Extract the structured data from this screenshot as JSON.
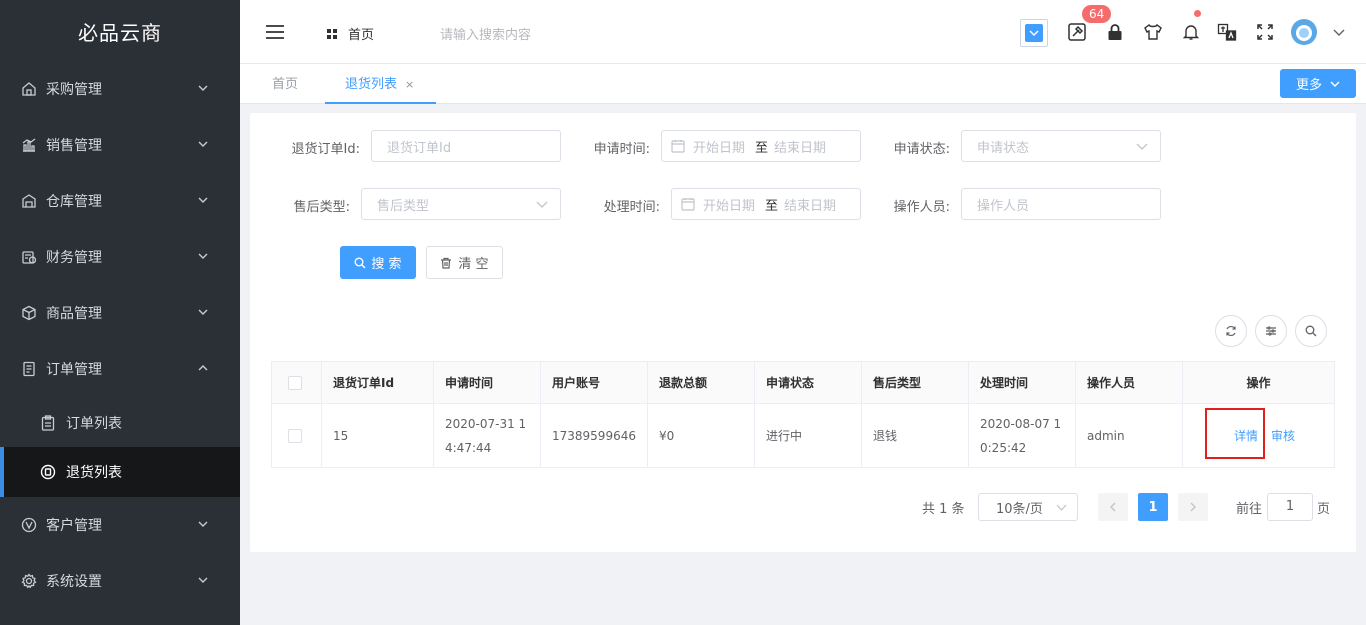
{
  "app": {
    "brand": "必品云商"
  },
  "sidebar": {
    "items": [
      {
        "label": "采购管理",
        "icon": "purchase-icon"
      },
      {
        "label": "销售管理",
        "icon": "sales-chart-icon"
      },
      {
        "label": "仓库管理",
        "icon": "warehouse-icon"
      },
      {
        "label": "财务管理",
        "icon": "finance-icon"
      },
      {
        "label": "商品管理",
        "icon": "box-icon"
      },
      {
        "label": "订单管理",
        "icon": "order-doc-icon"
      },
      {
        "label": "客户管理",
        "icon": "customer-icon"
      },
      {
        "label": "系统设置",
        "icon": "gear-icon"
      }
    ],
    "sub_items": [
      {
        "label": "订单列表",
        "icon": "clipboard-icon"
      },
      {
        "label": "退货列表",
        "icon": "return-icon"
      }
    ]
  },
  "header": {
    "home": "首页",
    "search_placeholder": "请输入搜索内容",
    "badge_count": "64"
  },
  "tabs": [
    {
      "label": "首页"
    },
    {
      "label": "退货列表",
      "close": "×"
    }
  ],
  "more_button": "更多",
  "form": {
    "order_id_label": "退货订单Id:",
    "order_id_placeholder": "退货订单Id",
    "apply_time_label": "申请时间:",
    "start_date": "开始日期",
    "to": "至",
    "end_date": "结束日期",
    "status_label": "申请状态:",
    "status_placeholder": "申请状态",
    "after_type_label": "售后类型:",
    "after_type_placeholder": "售后类型",
    "process_time_label": "处理时间:",
    "operator_label": "操作人员:",
    "operator_placeholder": "操作人员",
    "search_button": "搜 索",
    "clear_button": "清 空"
  },
  "table": {
    "headers": [
      "退货订单Id",
      "申请时间",
      "用户账号",
      "退款总额",
      "申请状态",
      "售后类型",
      "处理时间",
      "操作人员",
      "操作"
    ],
    "rows": [
      {
        "id": "15",
        "apply_time": "2020-07-31 14:47:44",
        "account": "17389599646",
        "amount": "¥0",
        "status": "进行中",
        "type": "退钱",
        "process_time": "2020-08-07 10:25:42",
        "operator": "admin",
        "detail": "详情",
        "audit": "审核"
      }
    ]
  },
  "pagination": {
    "total": "共 1 条",
    "page_size": "10条/页",
    "current": "1",
    "goto_label": "前往",
    "goto_value": "1",
    "page_unit": "页"
  }
}
